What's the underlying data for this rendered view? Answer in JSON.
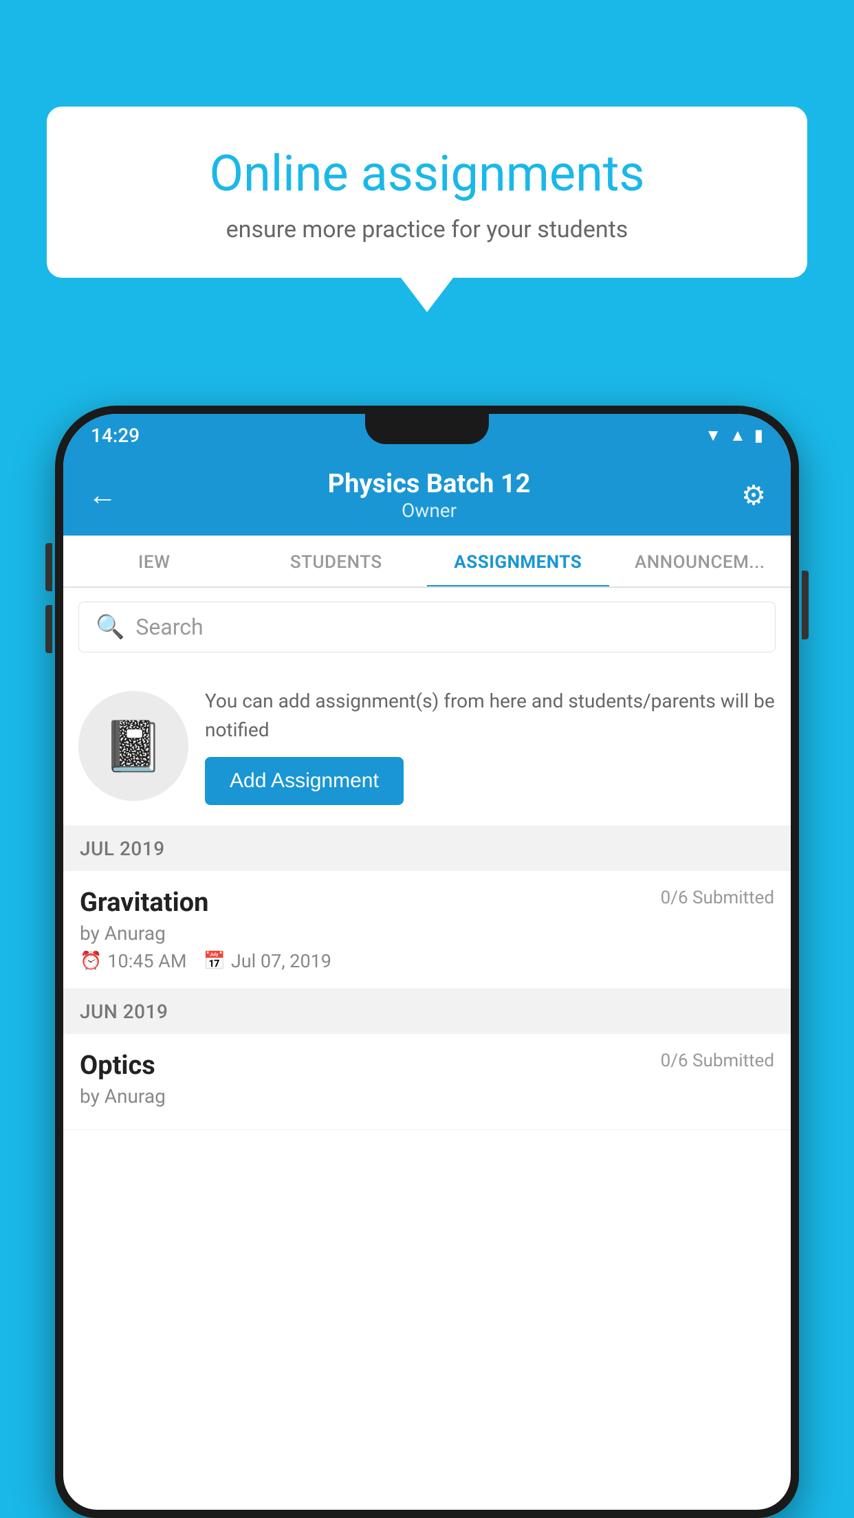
{
  "background_color": "#1ab8e8",
  "speech_bubble": {
    "title": "Online assignments",
    "subtitle": "ensure more practice for your students"
  },
  "phone": {
    "status_bar": {
      "time": "14:29",
      "icons": [
        "wifi",
        "signal",
        "battery"
      ]
    },
    "header": {
      "title": "Physics Batch 12",
      "subtitle": "Owner",
      "back_label": "←",
      "settings_label": "⚙"
    },
    "tabs": [
      {
        "label": "IEW",
        "active": false
      },
      {
        "label": "STUDENTS",
        "active": false
      },
      {
        "label": "ASSIGNMENTS",
        "active": true
      },
      {
        "label": "ANNOUNCEM...",
        "active": false
      }
    ],
    "search": {
      "placeholder": "Search"
    },
    "promo": {
      "text": "You can add assignment(s) from here and students/parents will be notified",
      "button_label": "Add Assignment"
    },
    "assignment_sections": [
      {
        "month": "JUL 2019",
        "assignments": [
          {
            "name": "Gravitation",
            "submitted": "0/6 Submitted",
            "by": "by Anurag",
            "time": "10:45 AM",
            "date": "Jul 07, 2019"
          }
        ]
      },
      {
        "month": "JUN 2019",
        "assignments": [
          {
            "name": "Optics",
            "submitted": "0/6 Submitted",
            "by": "by Anurag",
            "time": "",
            "date": ""
          }
        ]
      }
    ]
  }
}
